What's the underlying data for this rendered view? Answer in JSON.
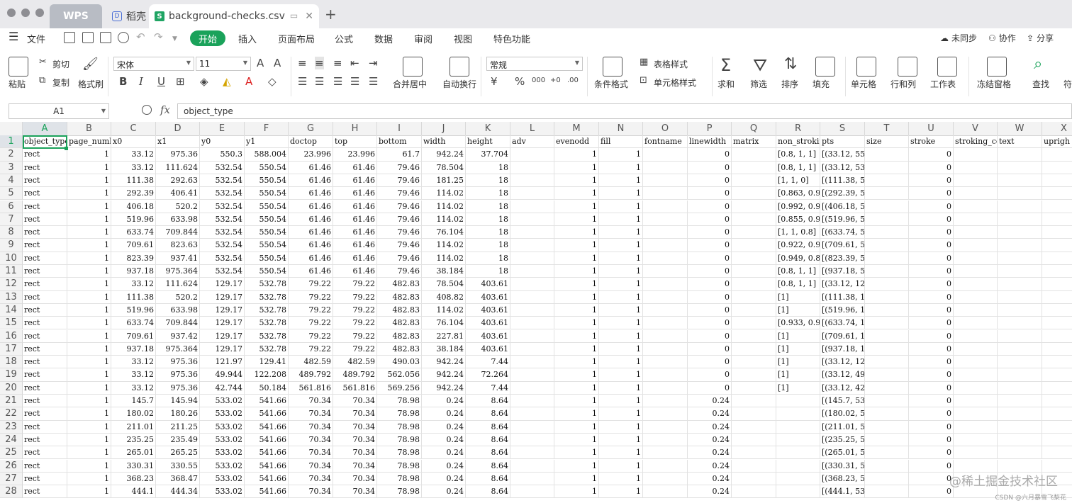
{
  "tabs": [
    {
      "label": "WPS"
    },
    {
      "label": "稻壳"
    },
    {
      "label": "background-checks.csv"
    }
  ],
  "menu": {
    "file": "文件",
    "start": "开始",
    "items": [
      "插入",
      "页面布局",
      "公式",
      "数据",
      "审阅",
      "视图",
      "特色功能"
    ],
    "right": [
      "未同步",
      "协作",
      "分享"
    ]
  },
  "ribbon": {
    "paste": "粘贴",
    "cut": "剪切",
    "copy": "复制",
    "format_painter": "格式刷",
    "font_name": "宋体",
    "font_size": "11",
    "number_format": "常规",
    "merge_center": "合并居中",
    "wrap_text": "自动换行",
    "cond_format": "条件格式",
    "table_style": "表格样式",
    "cell_style": "单元格样式",
    "sum": "求和",
    "filter": "筛选",
    "sort": "排序",
    "fill": "填充",
    "cell": "单元格",
    "row_col": "行和列",
    "worksheet": "工作表",
    "freeze": "冻结窗格",
    "find": "查找",
    "more": "符"
  },
  "formula_bar": {
    "name_box": "A1",
    "content": "object_type"
  },
  "columns": [
    "A",
    "B",
    "C",
    "D",
    "E",
    "F",
    "G",
    "H",
    "I",
    "J",
    "K",
    "L",
    "M",
    "N",
    "O",
    "P",
    "Q",
    "R",
    "S",
    "T",
    "U",
    "V",
    "W",
    "X"
  ],
  "rows": [
    "1",
    "2",
    "3",
    "4",
    "5",
    "6",
    "7",
    "8",
    "9",
    "10",
    "11",
    "12",
    "13",
    "14",
    "15",
    "16",
    "17",
    "18",
    "19",
    "20",
    "21",
    "22",
    "23",
    "24",
    "25",
    "26",
    "27",
    "28"
  ],
  "cells": [
    [
      "object_type",
      "page_numb",
      "x0",
      "x1",
      "y0",
      "y1",
      "doctop",
      "top",
      "bottom",
      "width",
      "height",
      "adv",
      "evenodd",
      "fill",
      "fontname",
      "linewidth",
      "matrix",
      "non_strokin",
      "pts",
      "size",
      "stroke",
      "stroking_co",
      "text",
      "uprigh"
    ],
    [
      "rect",
      "1",
      "33.12",
      "975.36",
      "550.3",
      "588.004",
      "23.996",
      "23.996",
      "61.7",
      "942.24",
      "37.704",
      "",
      "1",
      "1",
      "",
      "0",
      "",
      "[0.8, 1, 1]",
      "[(33.12, 550.3), (975.36, 5",
      "",
      "0",
      "",
      "",
      ""
    ],
    [
      "rect",
      "1",
      "33.12",
      "111.624",
      "532.54",
      "550.54",
      "61.46",
      "61.46",
      "79.46",
      "78.504",
      "18",
      "",
      "1",
      "1",
      "",
      "0",
      "",
      "[0.8, 1, 1]",
      "[(33.12, 532.54), (111.624",
      "",
      "0",
      "",
      "",
      ""
    ],
    [
      "rect",
      "1",
      "111.38",
      "292.63",
      "532.54",
      "550.54",
      "61.46",
      "61.46",
      "79.46",
      "181.25",
      "18",
      "",
      "1",
      "1",
      "",
      "0",
      "",
      "[1, 1, 0]",
      "[(111.38, 532.54), (292.63",
      "",
      "0",
      "",
      "",
      ""
    ],
    [
      "rect",
      "1",
      "292.39",
      "406.41",
      "532.54",
      "550.54",
      "61.46",
      "61.46",
      "79.46",
      "114.02",
      "18",
      "",
      "1",
      "1",
      "",
      "0",
      "",
      "[0.863, 0.902",
      "[(292.39, 532.54), (406.40",
      "",
      "0",
      "",
      "",
      ""
    ],
    [
      "rect",
      "1",
      "406.18",
      "520.2",
      "532.54",
      "550.54",
      "61.46",
      "61.46",
      "79.46",
      "114.02",
      "18",
      "",
      "1",
      "1",
      "",
      "0",
      "",
      "[0.992, 0.914",
      "[(406.18, 532.54), (520.2,",
      "",
      "0",
      "",
      "",
      ""
    ],
    [
      "rect",
      "1",
      "519.96",
      "633.98",
      "532.54",
      "550.54",
      "61.46",
      "61.46",
      "79.46",
      "114.02",
      "18",
      "",
      "1",
      "1",
      "",
      "0",
      "",
      "[0.855, 0.933",
      "[(519.96, 532.54), (633.98",
      "",
      "0",
      "",
      "",
      ""
    ],
    [
      "rect",
      "1",
      "633.74",
      "709.844",
      "532.54",
      "550.54",
      "61.46",
      "61.46",
      "79.46",
      "76.104",
      "18",
      "",
      "1",
      "1",
      "",
      "0",
      "",
      "[1, 1, 0.8]",
      "[(633.74, 532.54), (709.84",
      "",
      "0",
      "",
      "",
      ""
    ],
    [
      "rect",
      "1",
      "709.61",
      "823.63",
      "532.54",
      "550.54",
      "61.46",
      "61.46",
      "79.46",
      "114.02",
      "18",
      "",
      "1",
      "1",
      "",
      "0",
      "",
      "[0.922, 0.945",
      "[(709.61, 532.54), (823.63",
      "",
      "0",
      "",
      "",
      ""
    ],
    [
      "rect",
      "1",
      "823.39",
      "937.41",
      "532.54",
      "550.54",
      "61.46",
      "61.46",
      "79.46",
      "114.02",
      "18",
      "",
      "1",
      "1",
      "",
      "0",
      "",
      "[0.949, 0.863",
      "[(823.39, 532.54), (937.41",
      "",
      "0",
      "",
      "",
      ""
    ],
    [
      "rect",
      "1",
      "937.18",
      "975.364",
      "532.54",
      "550.54",
      "61.46",
      "61.46",
      "79.46",
      "38.184",
      "18",
      "",
      "1",
      "1",
      "",
      "0",
      "",
      "[0.8, 1, 1]",
      "[(937.18, 532.54), (975.36",
      "",
      "0",
      "",
      "",
      ""
    ],
    [
      "rect",
      "1",
      "33.12",
      "111.624",
      "129.17",
      "532.78",
      "79.22",
      "79.22",
      "482.83",
      "78.504",
      "403.61",
      "",
      "1",
      "1",
      "",
      "0",
      "",
      "[0.8, 1, 1]",
      "[(33.12, 129.17), (111.624",
      "",
      "0",
      "",
      "",
      ""
    ],
    [
      "rect",
      "1",
      "111.38",
      "520.2",
      "129.17",
      "532.78",
      "79.22",
      "79.22",
      "482.83",
      "408.82",
      "403.61",
      "",
      "1",
      "1",
      "",
      "0",
      "",
      "[1]",
      "[(111.38, 129.17), (520.2,",
      "",
      "0",
      "",
      "",
      ""
    ],
    [
      "rect",
      "1",
      "519.96",
      "633.98",
      "129.17",
      "532.78",
      "79.22",
      "79.22",
      "482.83",
      "114.02",
      "403.61",
      "",
      "1",
      "1",
      "",
      "0",
      "",
      "[1]",
      "[(519.96, 129.17), (633.98",
      "",
      "0",
      "",
      "",
      ""
    ],
    [
      "rect",
      "1",
      "633.74",
      "709.844",
      "129.17",
      "532.78",
      "79.22",
      "79.22",
      "482.83",
      "76.104",
      "403.61",
      "",
      "1",
      "1",
      "",
      "0",
      "",
      "[0.933, 0.925",
      "[(633.74, 129.17), (709.84",
      "",
      "0",
      "",
      "",
      ""
    ],
    [
      "rect",
      "1",
      "709.61",
      "937.42",
      "129.17",
      "532.78",
      "79.22",
      "79.22",
      "482.83",
      "227.81",
      "403.61",
      "",
      "1",
      "1",
      "",
      "0",
      "",
      "[1]",
      "[(709.61, 129.17), (937.42",
      "",
      "0",
      "",
      "",
      ""
    ],
    [
      "rect",
      "1",
      "937.18",
      "975.364",
      "129.17",
      "532.78",
      "79.22",
      "79.22",
      "482.83",
      "38.184",
      "403.61",
      "",
      "1",
      "1",
      "",
      "0",
      "",
      "[1]",
      "[(937.18, 129.17), (975.36",
      "",
      "0",
      "",
      "",
      ""
    ],
    [
      "rect",
      "1",
      "33.12",
      "975.36",
      "121.97",
      "129.41",
      "482.59",
      "482.59",
      "490.03",
      "942.24",
      "7.44",
      "",
      "1",
      "1",
      "",
      "0",
      "",
      "[1]",
      "[(33.12, 121.97), (975.36,",
      "",
      "0",
      "",
      "",
      ""
    ],
    [
      "rect",
      "1",
      "33.12",
      "975.36",
      "49.944",
      "122.208",
      "489.792",
      "489.792",
      "562.056",
      "942.24",
      "72.264",
      "",
      "1",
      "1",
      "",
      "0",
      "",
      "[1]",
      "[(33.12, 49.944), (975.36,",
      "",
      "0",
      "",
      "",
      ""
    ],
    [
      "rect",
      "1",
      "33.12",
      "975.36",
      "42.744",
      "50.184",
      "561.816",
      "561.816",
      "569.256",
      "942.24",
      "7.44",
      "",
      "1",
      "1",
      "",
      "0",
      "",
      "[1]",
      "[(33.12, 42.744), (975.36,",
      "",
      "0",
      "",
      "",
      ""
    ],
    [
      "rect",
      "1",
      "145.7",
      "145.94",
      "533.02",
      "541.66",
      "70.34",
      "70.34",
      "78.98",
      "0.24",
      "8.64",
      "",
      "1",
      "1",
      "",
      "0.24",
      "",
      "",
      "[(145.7, 533.02), (145.94,",
      "",
      "0",
      "",
      "",
      ""
    ],
    [
      "rect",
      "1",
      "180.02",
      "180.26",
      "533.02",
      "541.66",
      "70.34",
      "70.34",
      "78.98",
      "0.24",
      "8.64",
      "",
      "1",
      "1",
      "",
      "0.24",
      "",
      "",
      "[(180.02, 533.02), (180.26",
      "",
      "0",
      "",
      "",
      ""
    ],
    [
      "rect",
      "1",
      "211.01",
      "211.25",
      "533.02",
      "541.66",
      "70.34",
      "70.34",
      "78.98",
      "0.24",
      "8.64",
      "",
      "1",
      "1",
      "",
      "0.24",
      "",
      "",
      "[(211.01, 533.02), (211.25",
      "",
      "0",
      "",
      "",
      ""
    ],
    [
      "rect",
      "1",
      "235.25",
      "235.49",
      "533.02",
      "541.66",
      "70.34",
      "70.34",
      "78.98",
      "0.24",
      "8.64",
      "",
      "1",
      "1",
      "",
      "0.24",
      "",
      "",
      "[(235.25, 533.02), (235.49",
      "",
      "0",
      "",
      "",
      ""
    ],
    [
      "rect",
      "1",
      "265.01",
      "265.25",
      "533.02",
      "541.66",
      "70.34",
      "70.34",
      "78.98",
      "0.24",
      "8.64",
      "",
      "1",
      "1",
      "",
      "0.24",
      "",
      "",
      "[(265.01, 533.02), (265.25",
      "",
      "0",
      "",
      "",
      ""
    ],
    [
      "rect",
      "1",
      "330.31",
      "330.55",
      "533.02",
      "541.66",
      "70.34",
      "70.34",
      "78.98",
      "0.24",
      "8.64",
      "",
      "1",
      "1",
      "",
      "0.24",
      "",
      "",
      "[(330.31, 533.02), (330.55",
      "",
      "0",
      "",
      "",
      ""
    ],
    [
      "rect",
      "1",
      "368.23",
      "368.47",
      "533.02",
      "541.66",
      "70.34",
      "70.34",
      "78.98",
      "0.24",
      "8.64",
      "",
      "1",
      "1",
      "",
      "0.24",
      "",
      "",
      "[(368.23, 533.02), (368.47",
      "",
      "0",
      "",
      "",
      ""
    ],
    [
      "rect",
      "1",
      "444.1",
      "444.34",
      "533.02",
      "541.66",
      "70.34",
      "70.34",
      "78.98",
      "0.24",
      "8.64",
      "",
      "1",
      "1",
      "",
      "0.24",
      "",
      "",
      "[(444.1, 533.02), (444.340",
      "",
      "0",
      "",
      "",
      ""
    ]
  ],
  "watermark": "@稀土掘金技术社区",
  "credit": "CSDN @六月暴雪飞梨花"
}
